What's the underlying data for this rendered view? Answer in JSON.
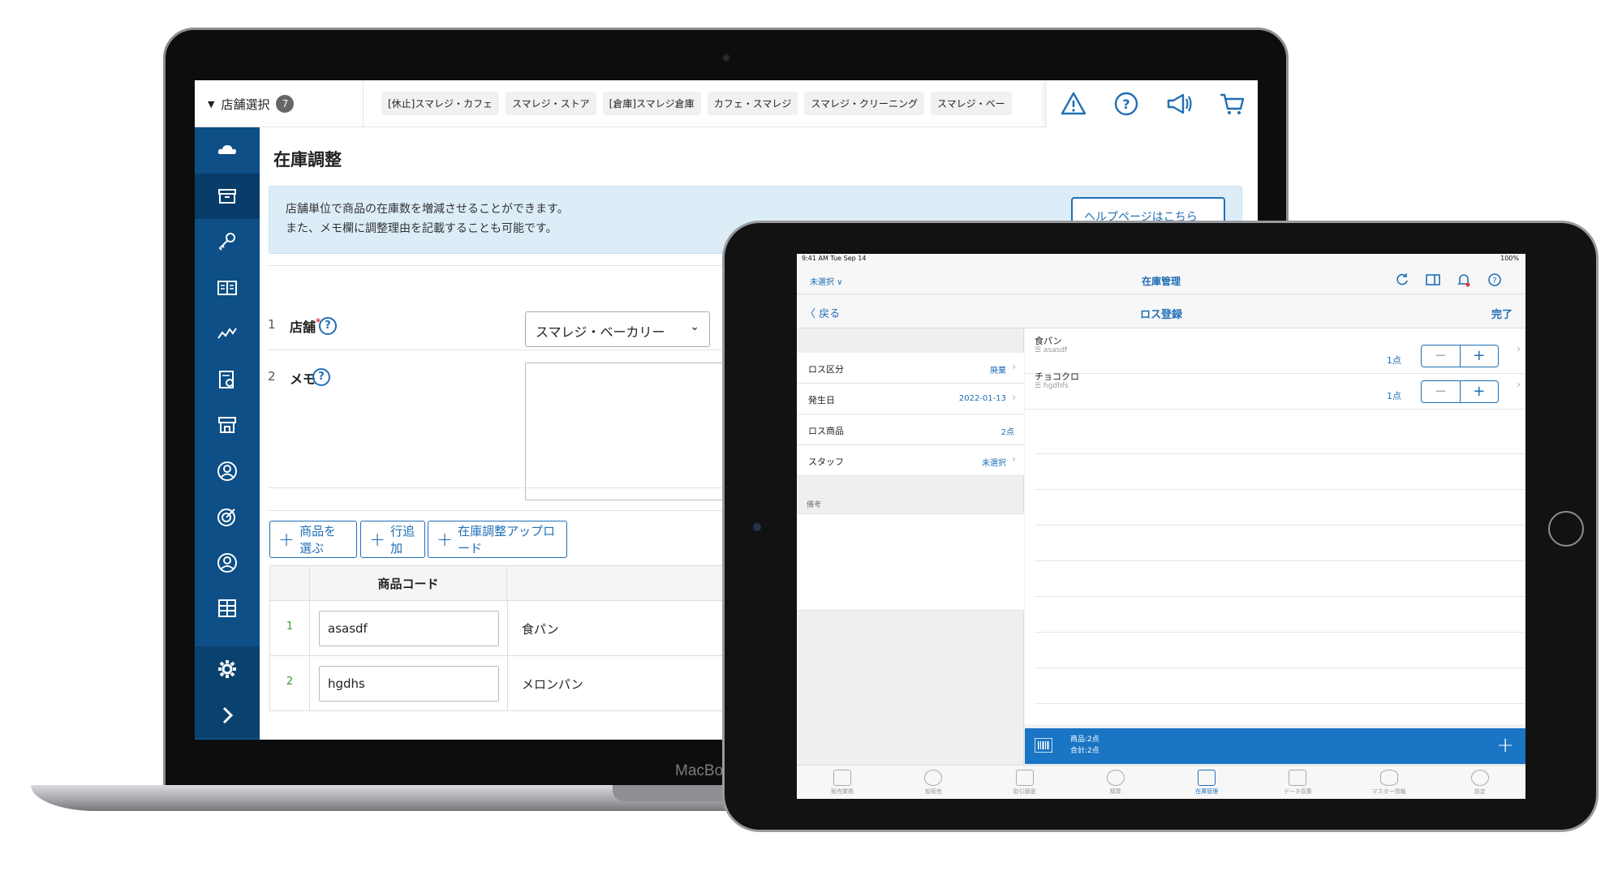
{
  "mac": {
    "chin_label": "MacBo",
    "topbar": {
      "store_select_label": "店舗選択",
      "store_count": "7",
      "store_tabs": [
        "[休止]スマレジ・カフェ",
        "スマレジ・ストア",
        "[倉庫]スマレジ倉庫",
        "カフェ・スマレジ",
        "スマレジ・クリーニング",
        "スマレジ・ベー"
      ],
      "icons": [
        "warning-icon",
        "help-icon",
        "megaphone-icon",
        "cart-icon"
      ]
    },
    "sidebar": {
      "items": [
        "cloud-icon",
        "archive-icon",
        "key-icon",
        "book-icon",
        "chart-icon",
        "report-icon",
        "store-icon",
        "user-icon",
        "target-icon",
        "profile-icon",
        "grid-icon"
      ],
      "bottom": [
        "gear-icon",
        "chevron-right-icon"
      ]
    },
    "page": {
      "title": "在庫調整",
      "info_line1": "店舗単位で商品の在庫数を増減させることができます。",
      "info_line2": "また、メモ欄に調整理由を記載することも可能です。",
      "help_button": "ヘルプページはこちら",
      "row1_num": "1",
      "row1_label": "店舗",
      "row1_required": "*",
      "row1_value": "スマレジ・ベーカリー",
      "row2_num": "2",
      "row2_label": "メモ",
      "qmark": "?",
      "buttons": {
        "select_product": "商品を選ぶ",
        "add_row": "行追加",
        "upload": "在庫調整アップロード"
      },
      "table": {
        "header_code": "商品コード",
        "rows": [
          {
            "num": "1",
            "code": "asasdf",
            "name": "食パン"
          },
          {
            "num": "2",
            "code": "hgdhs",
            "name": "メロンパン"
          }
        ]
      }
    }
  },
  "ipad": {
    "status_time": "9:41 AM  Tue Sep 14",
    "status_battery": "100%",
    "nav1_left": "未選択 ∨",
    "nav1_title": "在庫管理",
    "nav2_back": "〈 戻る",
    "nav2_title": "ロス登録",
    "nav2_done": "完了",
    "fields": [
      {
        "key": "ロス区分",
        "value": "廃棄"
      },
      {
        "key": "発生日",
        "value": "2022-01-13"
      },
      {
        "key": "ロス商品",
        "value": "2点"
      },
      {
        "key": "スタッフ",
        "value": "未選択"
      }
    ],
    "memo_label": "備考",
    "items": [
      {
        "name": "食パン",
        "code": "☰ asasdf",
        "qty": "1点"
      },
      {
        "name": "チョコクロ",
        "code": "☰ hgdhfs",
        "qty": "1点"
      }
    ],
    "footer_line1": "商品:2点",
    "footer_line2": "合計:2点",
    "footer_plus": "+",
    "tabs": [
      "販売業務",
      "仮販売",
      "取引履歴",
      "精算",
      "在庫管理",
      "データ収集",
      "マスター情報",
      "設定"
    ],
    "active_tab": "在庫管理"
  }
}
